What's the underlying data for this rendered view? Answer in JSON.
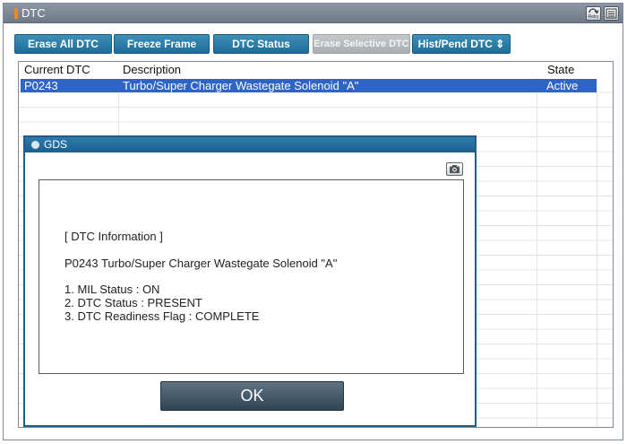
{
  "window": {
    "title": "DTC"
  },
  "titlebar": {
    "retry_icon": "retry-icon",
    "retry_label": "Retry",
    "menu_icon": "menu-icon"
  },
  "toolbar": {
    "erase_all": "Erase All DTC",
    "freeze_frame": "Freeze Frame",
    "dtc_status": "DTC Status",
    "erase_selective": "Erase Selective DTC",
    "hist_pend": "Hist/Pend DTC ⇕"
  },
  "table": {
    "columns": [
      "Current DTC",
      "Description",
      "State"
    ],
    "rows": [
      {
        "code": "P0243",
        "description": "Turbo/Super Charger Wastegate Solenoid \"A\"",
        "state": "Active",
        "selected": true
      }
    ]
  },
  "dialog": {
    "title": "GDS",
    "heading": "[ DTC Information ]",
    "dtc_line": "P0243 Turbo/Super Charger Wastegate Solenoid \"A\"",
    "items": [
      "1. MIL Status : ON",
      "2. DTC Status : PRESENT",
      "3. DTC Readiness Flag : COMPLETE"
    ],
    "ok_label": "OK"
  },
  "colors": {
    "title_marker": "#f08a1a",
    "toolbar_button": "#2b80ab",
    "selected_row": "#2f64c7",
    "dialog_frame": "#1f5d85"
  }
}
